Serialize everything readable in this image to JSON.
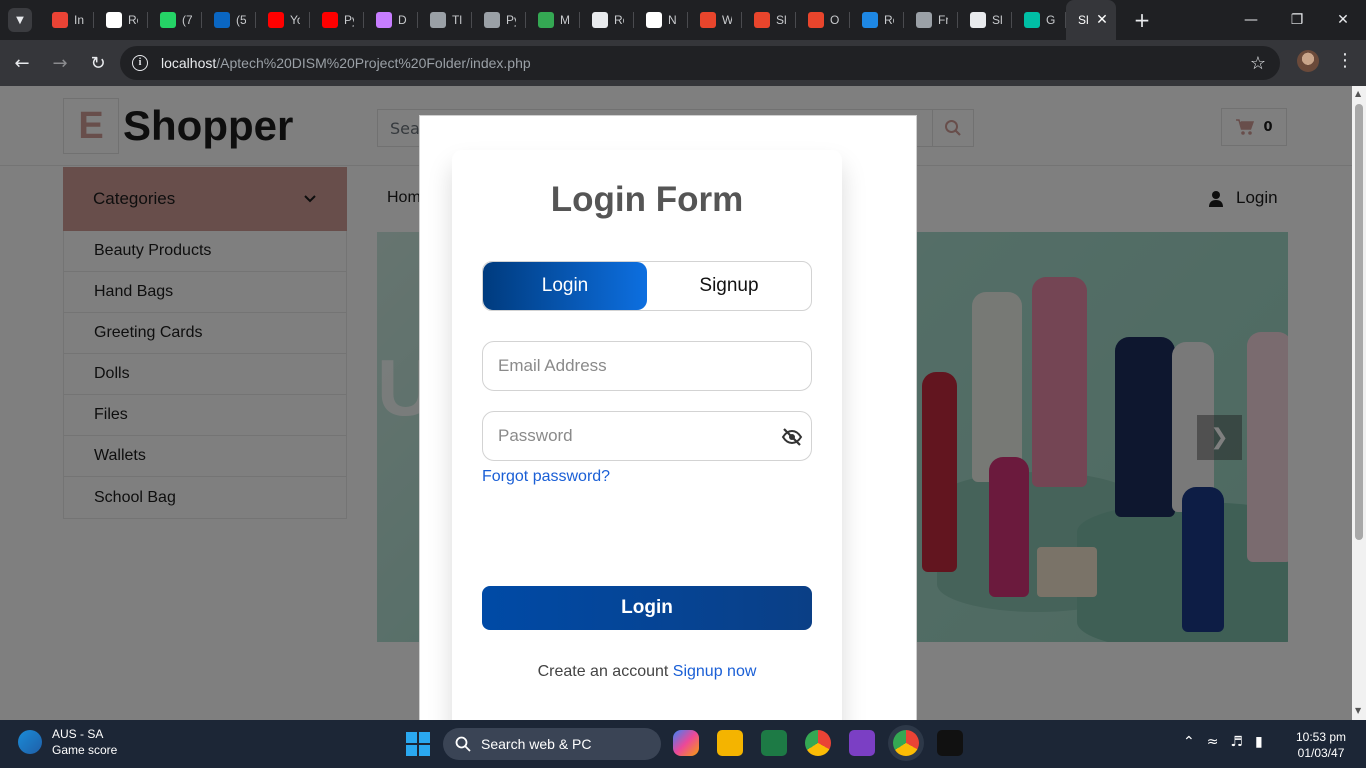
{
  "browser": {
    "tabs": [
      {
        "title": "In",
        "color": "#ea4335"
      },
      {
        "title": "Re",
        "color": "#ffffff"
      },
      {
        "title": "(7",
        "color": "#25d366"
      },
      {
        "title": "(5",
        "color": "#0a66c2"
      },
      {
        "title": "Yo",
        "color": "#ff0000"
      },
      {
        "title": "Py",
        "color": "#ff0000"
      },
      {
        "title": "D",
        "color": "#c77dff"
      },
      {
        "title": "Tl",
        "color": "#9aa0a6"
      },
      {
        "title": "Py",
        "color": "#9aa0a6"
      },
      {
        "title": "M",
        "color": "#34a853"
      },
      {
        "title": "Re",
        "color": "#e8eaed"
      },
      {
        "title": "N",
        "color": "#ffffff"
      },
      {
        "title": "W",
        "color": "#e8452c"
      },
      {
        "title": "Sl",
        "color": "#e8452c"
      },
      {
        "title": "O",
        "color": "#e8452c"
      },
      {
        "title": "Re",
        "color": "#1e88e5"
      },
      {
        "title": "Fr",
        "color": "#9aa0a6"
      },
      {
        "title": "Sl",
        "color": "#e8eaed"
      },
      {
        "title": "G",
        "color": "#00bfa5"
      }
    ],
    "active_tab_title": "Sl",
    "url_host": "localhost",
    "url_path": "/Aptech%20DISM%20Project%20Folder/index.php"
  },
  "site": {
    "logo_letter": "E",
    "logo_text": "Shopper",
    "search_placeholder": "Sea",
    "cart_count": "0",
    "categories_label": "Categories",
    "categories": [
      "Beauty Products",
      "Hand Bags",
      "Greeting Cards",
      "Dolls",
      "Files",
      "Wallets",
      "School Bag"
    ],
    "nav_home": "Hom",
    "nav_login": "Login",
    "banner_letter": "U"
  },
  "login_form": {
    "title": "Login Form",
    "tab_login": "Login",
    "tab_signup": "Signup",
    "email_placeholder": "Email Address",
    "password_placeholder": "Password",
    "forgot_password": "Forgot password?",
    "submit": "Login",
    "signup_prompt": "Create an account",
    "signup_link": "Signup now"
  },
  "taskbar": {
    "weather_title": "AUS - SA",
    "weather_sub": "Game score",
    "search_label": "Search web & PC",
    "time": "10:53 pm",
    "date": "01/03/47"
  }
}
